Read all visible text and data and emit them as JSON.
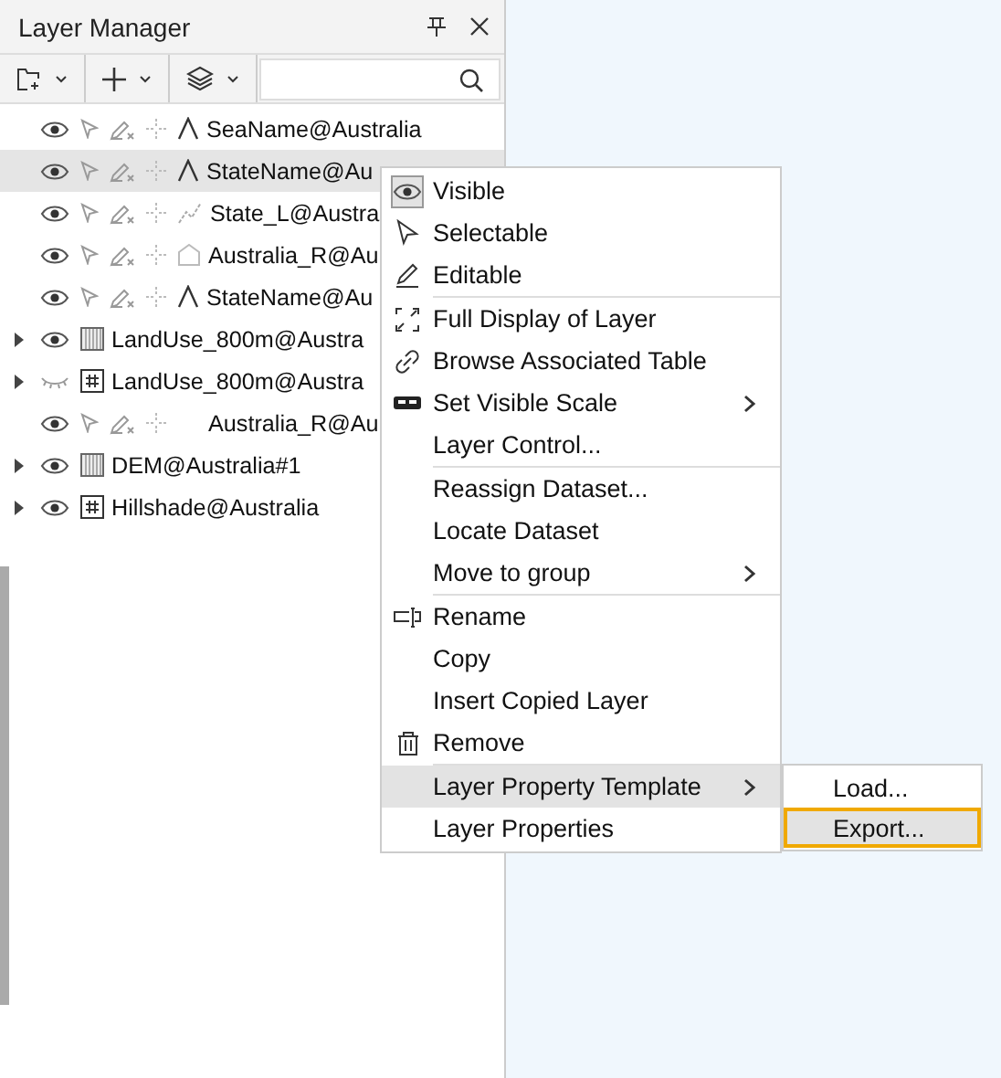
{
  "panel": {
    "title": "Layer Manager"
  },
  "layers": [
    {
      "name": "SeaName@Australia",
      "kind": "label",
      "visible": true,
      "selected": false
    },
    {
      "name": "StateName@Au",
      "kind": "label",
      "visible": true,
      "selected": true
    },
    {
      "name": "State_L@Austra",
      "kind": "line",
      "visible": true,
      "selected": false
    },
    {
      "name": "Australia_R@Au",
      "kind": "region",
      "visible": true,
      "selected": false
    },
    {
      "name": "StateName@Au",
      "kind": "label",
      "visible": true,
      "selected": false
    },
    {
      "name": "LandUse_800m@Austra",
      "kind": "grid",
      "visible": true,
      "selected": false
    },
    {
      "name": "LandUse_800m@Austra",
      "kind": "image",
      "visible": false,
      "selected": false
    },
    {
      "name": "Australia_R@Au",
      "kind": "blank",
      "visible": true,
      "selected": false
    },
    {
      "name": "DEM@Australia#1",
      "kind": "grid",
      "visible": true,
      "selected": false
    },
    {
      "name": "Hillshade@Australia",
      "kind": "image",
      "visible": true,
      "selected": false
    }
  ],
  "context_menu": [
    {
      "label": "Visible",
      "checked": true
    },
    {
      "label": "Selectable",
      "checked": false
    },
    {
      "label": "Editable",
      "checked": false
    },
    {
      "label": "Full Display of Layer",
      "separator": true
    },
    {
      "label": "Browse Associated Table"
    },
    {
      "label": "Set Visible Scale",
      "submenu": true
    },
    {
      "label": "Layer Control..."
    },
    {
      "label": "Reassign Dataset...",
      "separator": true
    },
    {
      "label": "Locate Dataset"
    },
    {
      "label": "Move to group",
      "submenu": true
    },
    {
      "label": "Rename",
      "separator": true
    },
    {
      "label": "Copy"
    },
    {
      "label": "Insert Copied Layer"
    },
    {
      "label": "Remove"
    },
    {
      "label": "Layer Property Template",
      "submenu": true,
      "separator": true,
      "selected": true
    },
    {
      "label": "Layer Properties",
      "selected": false
    }
  ],
  "submenu": [
    {
      "label": "Load...",
      "selected": false
    },
    {
      "label": "Export...",
      "selected": true
    }
  ]
}
